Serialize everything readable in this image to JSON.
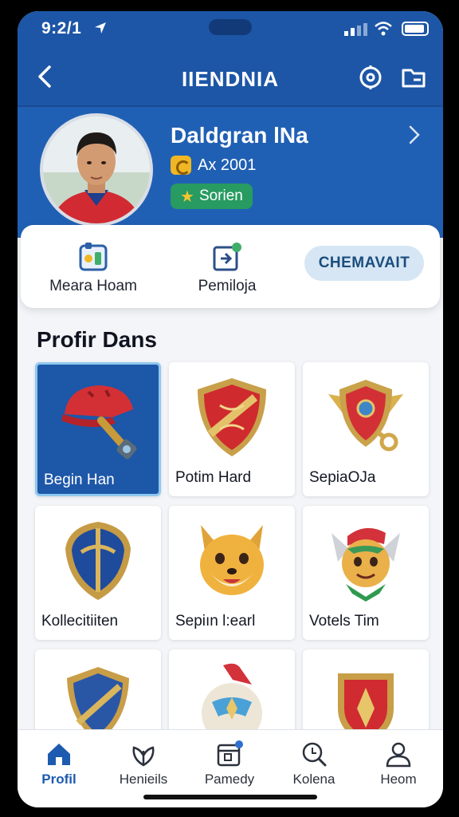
{
  "status": {
    "time": "9:2/1",
    "icons": [
      "location-arrow-icon",
      "signal-icon",
      "wifi-icon",
      "battery-icon"
    ]
  },
  "header": {
    "title": "IIENDNIA",
    "back_icon": "chevron-left-icon",
    "right_icons": [
      "target-icon",
      "folder-icon"
    ]
  },
  "profile": {
    "name": "Daldgran lNa",
    "rank_text": "Ax 2001",
    "badge": "Sorien",
    "avatar": "player-avatar"
  },
  "actions": {
    "items": [
      {
        "label": "Meara Hoam",
        "icon": "team-board-icon"
      },
      {
        "label": "Pemiloja",
        "icon": "share-badge-icon"
      }
    ],
    "cta_label": "CHEMAVAIT"
  },
  "section": {
    "title": "Profir Dans"
  },
  "collection": [
    {
      "label": "Begin Han",
      "art": "red-helmet-key",
      "selected": true
    },
    {
      "label": "Potim Hard",
      "art": "red-gold-shield",
      "selected": false
    },
    {
      "label": "SepiaOJa",
      "art": "winged-shield-key",
      "selected": false
    },
    {
      "label": "Kollecitiiten",
      "art": "blue-gold-shield",
      "selected": false
    },
    {
      "label": "Sepiın l:earl",
      "art": "fox-mascot",
      "selected": false
    },
    {
      "label": "Votels Tim",
      "art": "green-scarf-fox",
      "selected": false
    },
    {
      "label": "",
      "art": "blue-crest-shield",
      "selected": false
    },
    {
      "label": "",
      "art": "hooded-mask",
      "selected": false
    },
    {
      "label": "",
      "art": "red-emblem",
      "selected": false
    }
  ],
  "tabs": [
    {
      "label": "Profil",
      "icon": "home-icon",
      "active": true
    },
    {
      "label": "Henieils",
      "icon": "leaf-icon",
      "active": false
    },
    {
      "label": "Pamedy",
      "icon": "calendar-icon",
      "active": false
    },
    {
      "label": "Kolena",
      "icon": "search-icon",
      "active": false
    },
    {
      "label": "Heom",
      "icon": "person-icon",
      "active": false
    }
  ],
  "colors": {
    "header_blue": "#1d56a6",
    "badge_green": "#279b61",
    "active_tab": "#1d5bb0",
    "cta_bg": "#d6e6f4"
  }
}
